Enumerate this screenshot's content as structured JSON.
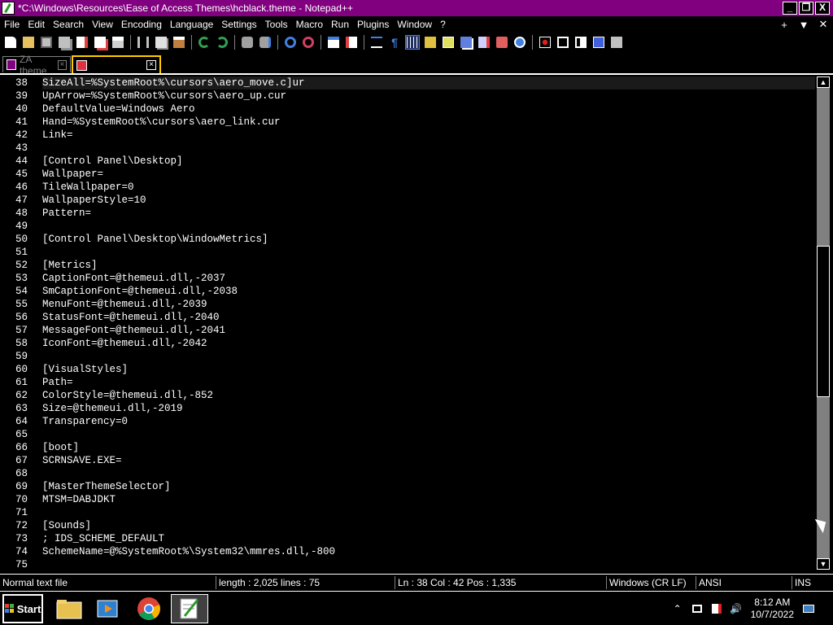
{
  "window": {
    "title": "*C:\\Windows\\Resources\\Ease of Access Themes\\hcblack.theme - Notepad++",
    "minimize": "_",
    "maximize": "❐",
    "close": "X"
  },
  "menu": {
    "items": [
      "File",
      "Edit",
      "Search",
      "View",
      "Encoding",
      "Language",
      "Settings",
      "Tools",
      "Macro",
      "Run",
      "Plugins",
      "Window",
      "?"
    ],
    "right": [
      "+",
      "▼",
      "✕"
    ]
  },
  "toolbar": {
    "icons": [
      "new-file-icon",
      "open-file-icon",
      "save-icon",
      "save-all-icon",
      "close-icon",
      "close-all-icon",
      "print-icon",
      "cut-icon",
      "copy-icon",
      "paste-icon",
      "undo-icon",
      "redo-icon",
      "find-icon",
      "replace-icon",
      "zoom-in-icon",
      "zoom-out-icon",
      "sync-vertical-icon",
      "sync-horizontal-icon",
      "word-wrap-icon",
      "show-all-chars-icon",
      "indent-guide-icon",
      "udl-icon",
      "doc-map-icon",
      "function-list-icon",
      "folder-workspace-icon",
      "monitoring-icon",
      "record-macro-icon",
      "stop-record-icon",
      "play-macro-icon",
      "run-macro-multiple-icon",
      "save-macro-icon"
    ]
  },
  "tabs": [
    {
      "label": "ZA theme",
      "active": false
    },
    {
      "label": "",
      "active": true
    }
  ],
  "editor": {
    "current_line": 38,
    "lines": [
      {
        "n": "38",
        "t": "SizeAll=%SystemRoot%\\cursors\\aero_move.c]ur"
      },
      {
        "n": "39",
        "t": "UpArrow=%SystemRoot%\\cursors\\aero_up.cur"
      },
      {
        "n": "40",
        "t": "DefaultValue=Windows Aero"
      },
      {
        "n": "41",
        "t": "Hand=%SystemRoot%\\cursors\\aero_link.cur"
      },
      {
        "n": "42",
        "t": "Link="
      },
      {
        "n": "43",
        "t": ""
      },
      {
        "n": "44",
        "t": "[Control Panel\\Desktop]"
      },
      {
        "n": "45",
        "t": "Wallpaper="
      },
      {
        "n": "46",
        "t": "TileWallpaper=0"
      },
      {
        "n": "47",
        "t": "WallpaperStyle=10"
      },
      {
        "n": "48",
        "t": "Pattern="
      },
      {
        "n": "49",
        "t": ""
      },
      {
        "n": "50",
        "t": "[Control Panel\\Desktop\\WindowMetrics]"
      },
      {
        "n": "51",
        "t": ""
      },
      {
        "n": "52",
        "t": "[Metrics]"
      },
      {
        "n": "53",
        "t": "CaptionFont=@themeui.dll,-2037"
      },
      {
        "n": "54",
        "t": "SmCaptionFont=@themeui.dll,-2038"
      },
      {
        "n": "55",
        "t": "MenuFont=@themeui.dll,-2039"
      },
      {
        "n": "56",
        "t": "StatusFont=@themeui.dll,-2040"
      },
      {
        "n": "57",
        "t": "MessageFont=@themeui.dll,-2041"
      },
      {
        "n": "58",
        "t": "IconFont=@themeui.dll,-2042"
      },
      {
        "n": "59",
        "t": ""
      },
      {
        "n": "60",
        "t": "[VisualStyles]"
      },
      {
        "n": "61",
        "t": "Path="
      },
      {
        "n": "62",
        "t": "ColorStyle=@themeui.dll,-852"
      },
      {
        "n": "63",
        "t": "Size=@themeui.dll,-2019"
      },
      {
        "n": "64",
        "t": "Transparency=0"
      },
      {
        "n": "65",
        "t": ""
      },
      {
        "n": "66",
        "t": "[boot]"
      },
      {
        "n": "67",
        "t": "SCRNSAVE.EXE="
      },
      {
        "n": "68",
        "t": ""
      },
      {
        "n": "69",
        "t": "[MasterThemeSelector]"
      },
      {
        "n": "70",
        "t": "MTSM=DABJDKT"
      },
      {
        "n": "71",
        "t": ""
      },
      {
        "n": "72",
        "t": "[Sounds]"
      },
      {
        "n": "73",
        "t": "; IDS_SCHEME_DEFAULT"
      },
      {
        "n": "74",
        "t": "SchemeName=@%SystemRoot%\\System32\\mmres.dll,-800"
      },
      {
        "n": "75",
        "t": ""
      }
    ]
  },
  "status": {
    "filetype": "Normal text file",
    "length": "length : 2,025    lines : 75",
    "position": "Ln : 38    Col : 42    Pos : 1,335",
    "eol": "Windows (CR LF)",
    "encoding": "ANSI",
    "mode": "INS"
  },
  "taskbar": {
    "start_label": "Start",
    "apps": [
      "file-explorer-icon",
      "media-player-icon",
      "chrome-icon",
      "notepadpp-icon"
    ],
    "time": "8:12 AM",
    "date": "10/7/2022"
  },
  "colors": {
    "title_bg": "#800080",
    "background": "#000000",
    "text": "#ffffff",
    "active_tab_border": "#ffcc00"
  }
}
